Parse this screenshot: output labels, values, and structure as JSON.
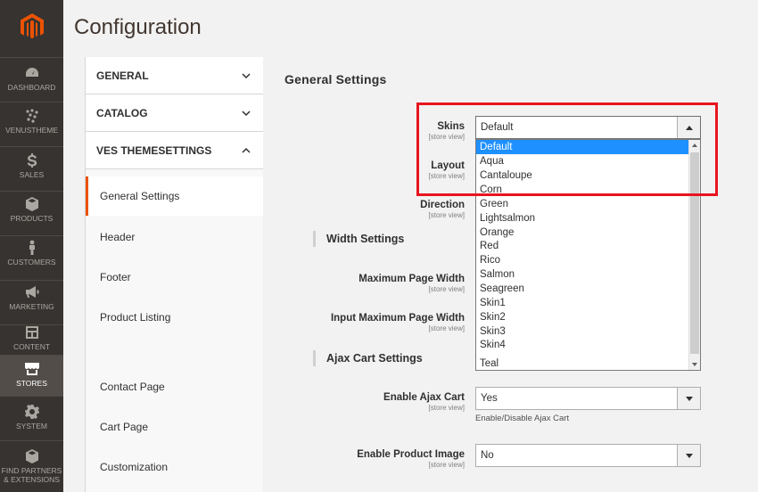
{
  "nav": {
    "items": [
      {
        "label": "DASHBOARD",
        "icon": "dashboard-icon"
      },
      {
        "label": "VENUSTHEME",
        "icon": "venustheme-icon"
      },
      {
        "label": "SALES",
        "icon": "dollar-icon"
      },
      {
        "label": "PRODUCTS",
        "icon": "box-icon"
      },
      {
        "label": "CUSTOMERS",
        "icon": "person-icon"
      },
      {
        "label": "MARKETING",
        "icon": "megaphone-icon"
      },
      {
        "label": "CONTENT",
        "icon": "layout-icon"
      },
      {
        "label": "STORES",
        "icon": "store-icon"
      },
      {
        "label": "SYSTEM",
        "icon": "gear-icon"
      },
      {
        "label": "FIND PARTNERS & EXTENSIONS",
        "icon": "extensions-icon"
      }
    ],
    "active": "STORES",
    "brand_color": "#eb5202"
  },
  "page": {
    "title": "Configuration"
  },
  "tabs": {
    "groups": [
      {
        "label": "GENERAL",
        "expanded": false
      },
      {
        "label": "CATALOG",
        "expanded": false
      },
      {
        "label": "VES THEMESETTINGS",
        "expanded": true
      }
    ],
    "subtabs": [
      "General Settings",
      "Header",
      "Footer",
      "Product Listing",
      "Contact Page",
      "Cart Page",
      "Customization"
    ],
    "active_subtab": "General Settings"
  },
  "main": {
    "section_title": "General Settings",
    "scope_label": "[store view]",
    "fields": {
      "skins": {
        "label": "Skins",
        "value": "Default"
      },
      "layout": {
        "label": "Layout"
      },
      "direction": {
        "label": "Direction"
      },
      "max_page_width": {
        "label": "Maximum Page Width"
      },
      "input_max_page_width": {
        "label": "Input Maximum Page Width"
      },
      "enable_ajax_cart": {
        "label": "Enable Ajax Cart",
        "value": "Yes",
        "note": "Enable/Disable Ajax Cart"
      },
      "enable_product_image": {
        "label": "Enable Product Image",
        "value": "No"
      }
    },
    "groups": {
      "width": "Width Settings",
      "ajax": "Ajax Cart Settings"
    }
  },
  "dropdown": {
    "options": [
      "Default",
      "Aqua",
      "Cantaloupe",
      "Corn",
      "Green",
      "Lightsalmon",
      "Orange",
      "Red",
      "Rico",
      "Salmon",
      "Seagreen",
      "Skin1",
      "Skin2",
      "Skin3",
      "Skin4",
      "Teal"
    ],
    "selected": "Default",
    "highlight_color": "#1e90ff"
  },
  "annotation": {
    "highlight_color": "#e8141f"
  }
}
